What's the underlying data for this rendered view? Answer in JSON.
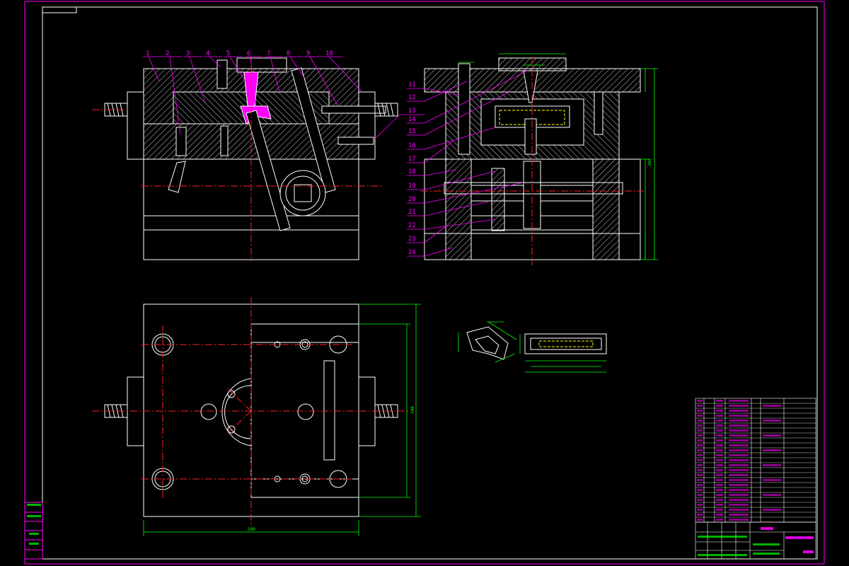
{
  "drawing": {
    "part_numbers": [
      "1",
      "2",
      "3",
      "4",
      "5",
      "6",
      "7",
      "8",
      "9",
      "10",
      "11",
      "12",
      "13",
      "14",
      "15",
      "16",
      "17",
      "18",
      "19",
      "20",
      "21",
      "22",
      "23",
      "24"
    ],
    "dimensions": {
      "front_width": "500",
      "front_height": "300",
      "side_total_height": "360",
      "plan_width": "500",
      "plan_height": "300"
    },
    "colors": {
      "background": "#000000",
      "outline": "#ffffff",
      "centerline": "#ff2020",
      "hatch": "#ffffff",
      "dimension": "#00ff00",
      "leader": "#ff00ff",
      "frame": "#ff00ff",
      "hidden": "#ffff00"
    }
  }
}
